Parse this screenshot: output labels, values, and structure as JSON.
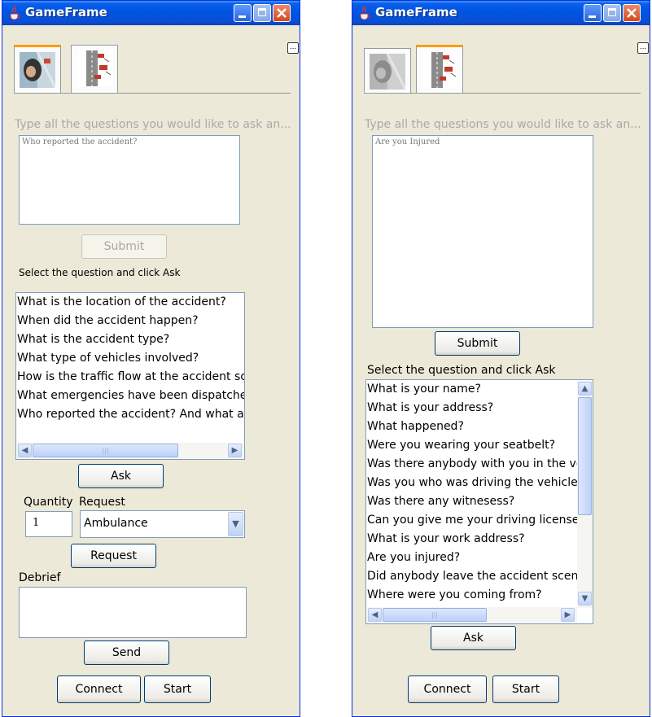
{
  "windows": [
    {
      "title": "GameFrame",
      "more_button": "...",
      "prompt": "Type all the questions you would like to ask an...",
      "question_text": "Who reported the accident?",
      "submit_label": "Submit",
      "select_prompt": "Select the question and click Ask",
      "questions": [
        "What is the location of the accident?",
        "When did the accident happen?",
        "What is the accident type?",
        "What type of vehicles involved?",
        "How is the traffic flow at the accident sce",
        "What emergencies have been dispatched",
        "Who reported the accident? And what are"
      ],
      "ask_label": "Ask",
      "quantity_label": "Quantity",
      "request_label": "Request",
      "quantity_value": "1",
      "request_value": "Ambulance",
      "request_button_label": "Request",
      "debrief_label": "Debrief",
      "debrief_value": "",
      "send_label": "Send",
      "connect_label": "Connect",
      "start_label": "Start"
    },
    {
      "title": "GameFrame",
      "more_button": "...",
      "prompt": "Type all the questions you would like to ask an...",
      "question_text": "Are you Injured",
      "submit_label": "Submit",
      "select_prompt": "Select the question and click Ask",
      "questions": [
        "What is your name?",
        "What is your address?",
        "What happened?",
        "Were you wearing your seatbelt?",
        "Was there anybody with you in the ve",
        "Was you who was driving the vehicle?",
        "Was there any witnesess?",
        "Can you give me your driving license a",
        "What is your work address?",
        "Are you injured?",
        "Did anybody leave the accident scene",
        "Where were you coming from?"
      ],
      "ask_label": "Ask",
      "connect_label": "Connect",
      "start_label": "Start"
    }
  ],
  "icons": {
    "app": "java-cup-icon",
    "minimize": "minimize-icon",
    "maximize": "maximize-icon",
    "close": "close-icon",
    "tab1": "accident-photo-icon",
    "tab2": "road-map-icon"
  },
  "colors": {
    "titlebar": "#0054e3",
    "window_bg": "#ece9d8",
    "close_button": "#d2471e",
    "selected_tab_accent": "#ff9c00"
  }
}
